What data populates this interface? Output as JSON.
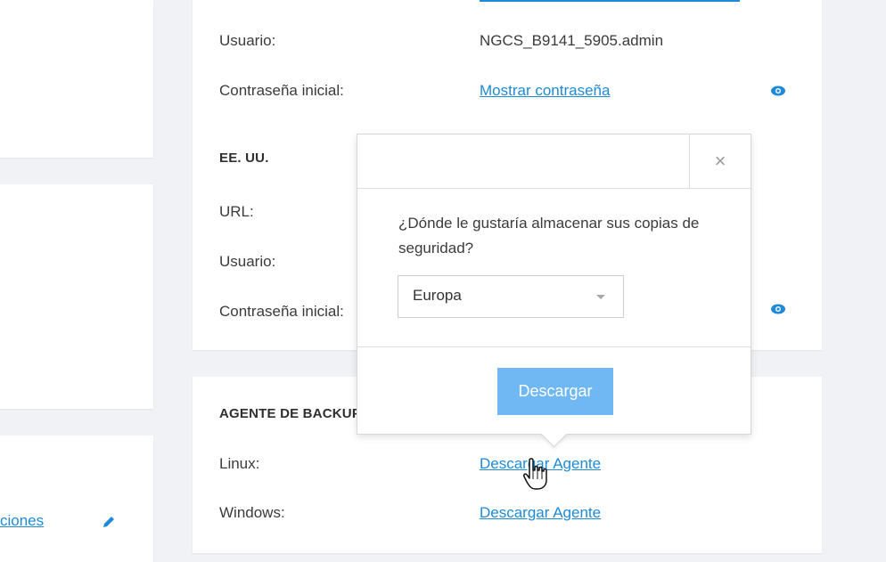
{
  "left_cards": {
    "configuraciones_link": "ciones"
  },
  "credentials": {
    "top": {
      "user_label": "Usuario:",
      "user_value": "NGCS_B9141_5905.admin",
      "password_label": "Contraseña inicial:",
      "password_link": "Mostrar contraseña"
    },
    "us": {
      "title": "EE. UU.",
      "url_label": "URL:",
      "user_label": "Usuario:",
      "password_label": "Contraseña inicial:"
    }
  },
  "agent": {
    "title": "AGENTE DE BACKUP",
    "linux_label": "Linux:",
    "linux_link": "Descargar Agente",
    "windows_label": "Windows:",
    "windows_link": "Descargar Agente"
  },
  "popover": {
    "close_symbol": "×",
    "question": "¿Dónde le gustaría almacenar sus copias de seguridad?",
    "select_value": "Europa",
    "download_label": "Descargar"
  },
  "icons": {
    "eye_icon": "eye-icon",
    "edit_icon": "pencil-icon",
    "close_icon": "close-icon",
    "cursor_icon": "hand-pointer-icon"
  },
  "colors": {
    "link": "#1f8ad8",
    "button": "#70b8f3",
    "background": "#f0f2f5"
  }
}
